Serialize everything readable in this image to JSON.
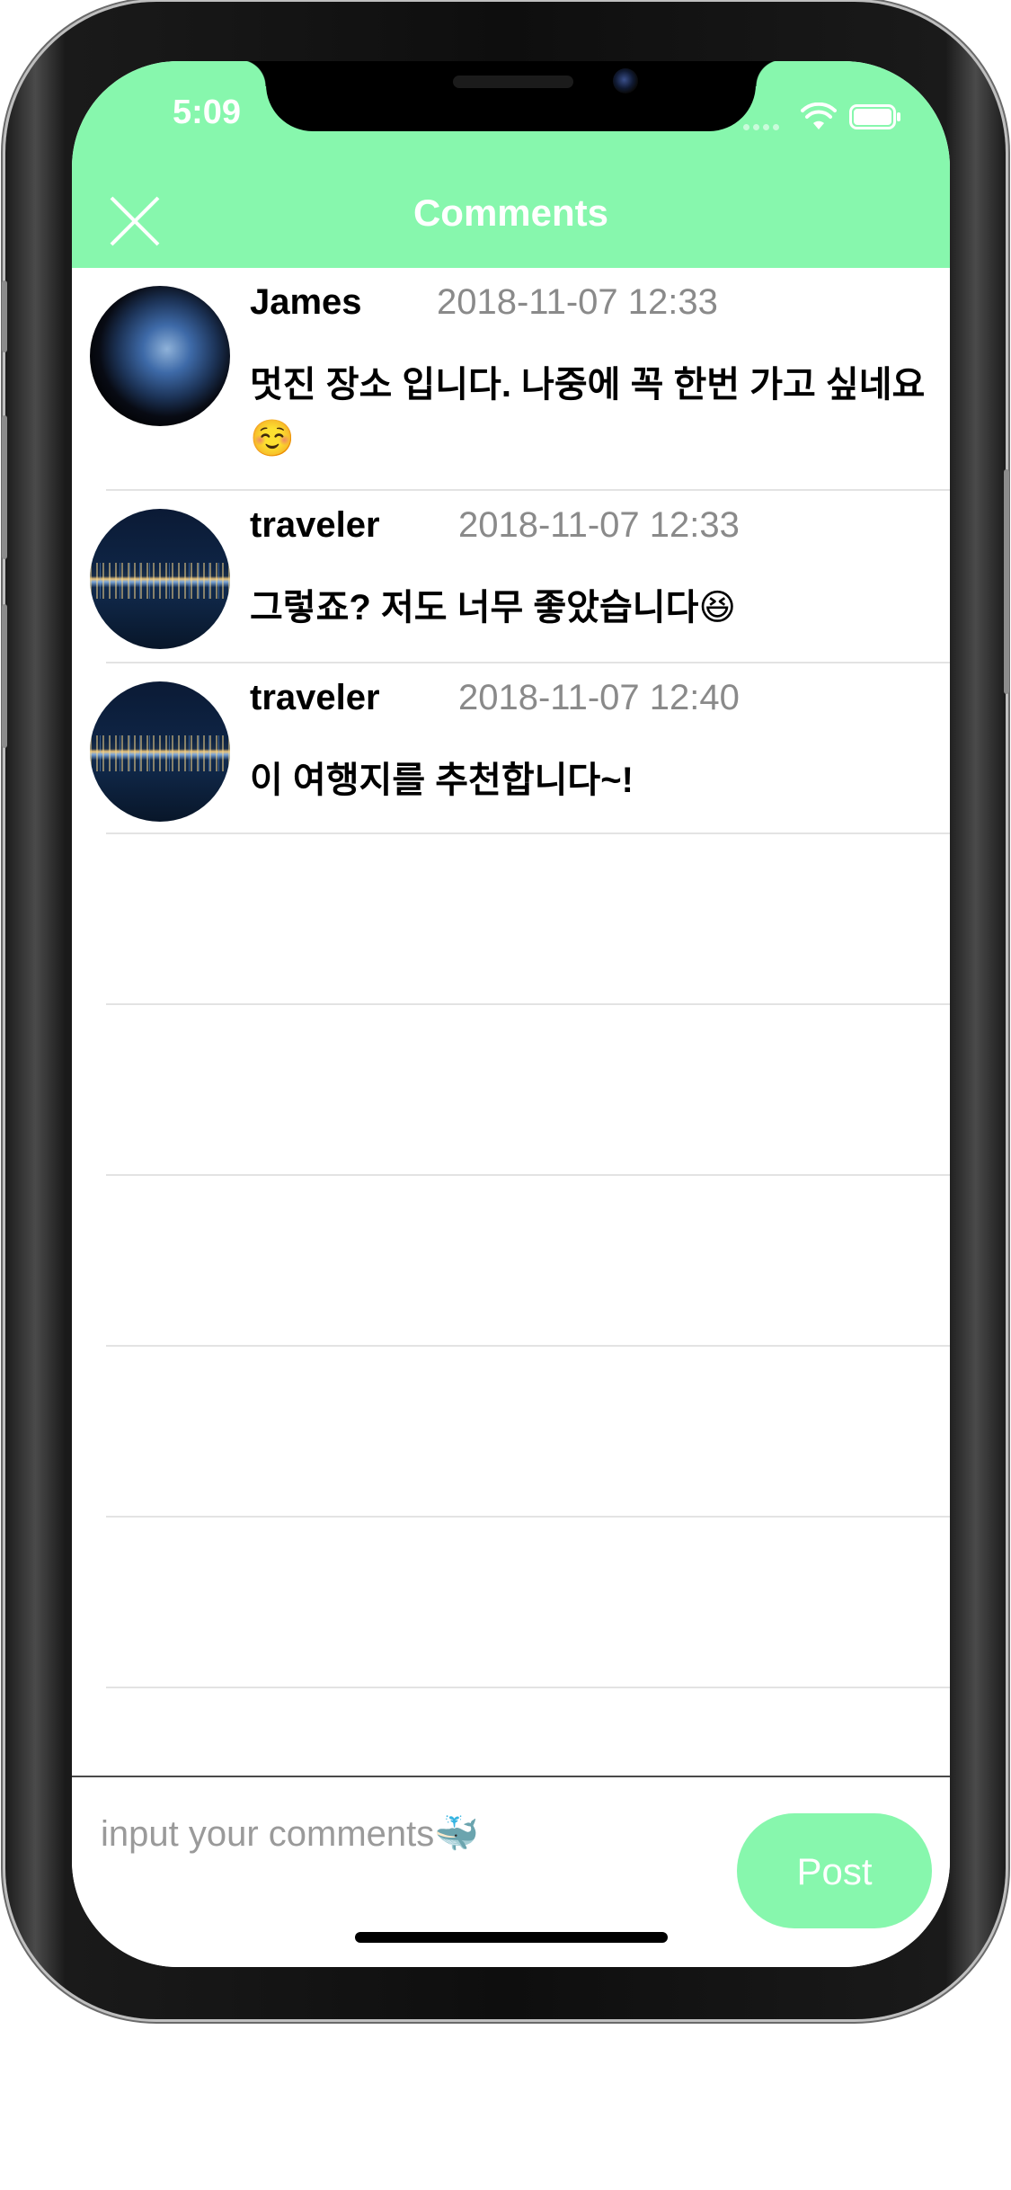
{
  "status_bar": {
    "time": "5:09"
  },
  "nav": {
    "title": "Comments"
  },
  "colors": {
    "accent": "#87f7ad",
    "header_text": "#ffffff",
    "timestamp": "#8a8a8a"
  },
  "comments": [
    {
      "user": "James",
      "timestamp": "2018-11-07 12:33",
      "text": "멋진 장소 입니다. 나중에 꼭 한번 가고 싶네요☺️",
      "avatar": "earth-avatar"
    },
    {
      "user": "traveler",
      "timestamp": "2018-11-07 12:33",
      "text": "그렇죠? 저도 너무 좋았습니다😆",
      "avatar": "city-night-avatar"
    },
    {
      "user": "traveler",
      "timestamp": "2018-11-07 12:40",
      "text": "이 여행지를 추천합니다~!",
      "avatar": "city-night-avatar"
    }
  ],
  "input": {
    "placeholder": "input your comments🐳",
    "value": ""
  },
  "post_button": {
    "label": "Post"
  }
}
